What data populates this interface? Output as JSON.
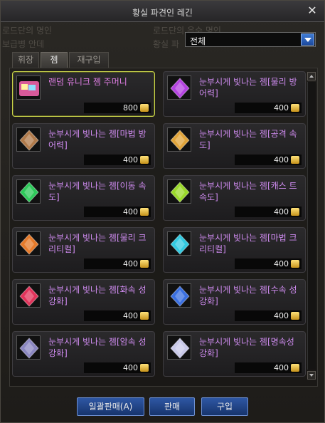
{
  "window": {
    "title": "황실 파견인 레긴"
  },
  "background_text": [
    "로드단의 명인",
    "보급병 안데",
    "로드단의 은수 명인",
    "황실 파"
  ],
  "filter": {
    "selected": "전체"
  },
  "tabs": [
    {
      "label": "휘장",
      "active": false
    },
    {
      "label": "젬",
      "active": true
    },
    {
      "label": "재구입",
      "active": false
    }
  ],
  "items": [
    {
      "name": "랜덤 유니크 젬 주머니",
      "price": "800",
      "icon": "gem-pouch-icon",
      "color": "#d85a9a",
      "selected": true
    },
    {
      "name": "눈부시게 빛나는 젬[물리 방어력]",
      "price": "400",
      "icon": "purple-gem-icon",
      "color": "#b443e0",
      "selected": false
    },
    {
      "name": "눈부시게 빛나는 젬[마법 방어력]",
      "price": "400",
      "icon": "bronze-gem-icon",
      "color": "#b07a4a",
      "selected": false
    },
    {
      "name": "눈부시게 빛나는 젬[공격 속도]",
      "price": "400",
      "icon": "gold-gem-icon",
      "color": "#e0a43a",
      "selected": false
    },
    {
      "name": "눈부시게 빛나는 젬[이동 속도]",
      "price": "400",
      "icon": "green-gem-icon",
      "color": "#2ec95a",
      "selected": false
    },
    {
      "name": "눈부시게 빛나는 젬[캐스 트속도]",
      "price": "400",
      "icon": "lime-gem-icon",
      "color": "#9ad82a",
      "selected": false
    },
    {
      "name": "눈부시게 빛나는 젬[물리 크리티컬]",
      "price": "400",
      "icon": "orange-gem-icon",
      "color": "#e57a2a",
      "selected": false
    },
    {
      "name": "눈부시게 빛나는 젬[마법 크리티컬]",
      "price": "400",
      "icon": "cyan-gem-icon",
      "color": "#33c9e0",
      "selected": false
    },
    {
      "name": "눈부시게 빛나는 젬[화속 성강화]",
      "price": "400",
      "icon": "red-gem-icon",
      "color": "#e0335a",
      "selected": false
    },
    {
      "name": "눈부시게 빛나는 젬[수속 성강화]",
      "price": "400",
      "icon": "blue-gem-icon",
      "color": "#3a6fe0",
      "selected": false
    },
    {
      "name": "눈부시게 빛나는 젬[암속 성강화]",
      "price": "400",
      "icon": "dark-gem-icon",
      "color": "#8a86c0",
      "selected": false
    },
    {
      "name": "눈부시게 빛나는 젬[명속성 강화]",
      "price": "400",
      "icon": "white-gem-icon",
      "color": "#c8c8e8",
      "selected": false
    }
  ],
  "buttons": {
    "bulk_sell": "일괄판매(A)",
    "sell": "판매",
    "buy": "구입"
  }
}
